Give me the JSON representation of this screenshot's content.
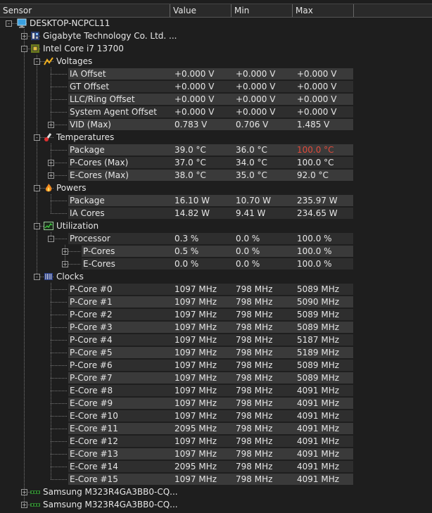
{
  "columns": [
    "Sensor",
    "Value",
    "Min",
    "Max"
  ],
  "tree": [
    {
      "depth": 0,
      "icon": "computer-icon",
      "label": "DESKTOP-NCPCL11",
      "expander": "-"
    },
    {
      "depth": 1,
      "icon": "motherboard-icon",
      "label": "Gigabyte Technology Co. Ltd. ...",
      "expander": "+"
    },
    {
      "depth": 1,
      "icon": "cpu-icon",
      "label": "Intel Core i7 13700",
      "expander": "-"
    },
    {
      "depth": 2,
      "icon": "voltage-icon",
      "label": "Voltages",
      "expander": "-"
    },
    {
      "depth": 3,
      "label": "IA Offset",
      "value": "+0.000 V",
      "min": "+0.000 V",
      "max": "+0.000 V"
    },
    {
      "depth": 3,
      "label": "GT Offset",
      "value": "+0.000 V",
      "min": "+0.000 V",
      "max": "+0.000 V"
    },
    {
      "depth": 3,
      "label": "LLC/Ring Offset",
      "value": "+0.000 V",
      "min": "+0.000 V",
      "max": "+0.000 V"
    },
    {
      "depth": 3,
      "label": "System Agent Offset",
      "value": "+0.000 V",
      "min": "+0.000 V",
      "max": "+0.000 V"
    },
    {
      "depth": 3,
      "label": "VID (Max)",
      "value": "0.783 V",
      "min": "0.706 V",
      "max": "1.485 V",
      "expander": "+"
    },
    {
      "depth": 2,
      "icon": "thermometer-icon",
      "label": "Temperatures",
      "expander": "-"
    },
    {
      "depth": 3,
      "label": "Package",
      "value": "39.0 °C",
      "min": "36.0 °C",
      "max": "100.0 °C",
      "maxColor": "#e04a3a"
    },
    {
      "depth": 3,
      "label": "P-Cores (Max)",
      "value": "37.0 °C",
      "min": "34.0 °C",
      "max": "100.0 °C",
      "expander": "+"
    },
    {
      "depth": 3,
      "label": "E-Cores (Max)",
      "value": "38.0 °C",
      "min": "35.0 °C",
      "max": "92.0 °C",
      "expander": "+"
    },
    {
      "depth": 2,
      "icon": "flame-icon",
      "label": "Powers",
      "expander": "-"
    },
    {
      "depth": 3,
      "label": "Package",
      "value": "16.10 W",
      "min": "10.70 W",
      "max": "235.97 W"
    },
    {
      "depth": 3,
      "label": "IA Cores",
      "value": "14.82 W",
      "min": "9.41 W",
      "max": "234.65 W"
    },
    {
      "depth": 2,
      "icon": "utilization-icon",
      "label": "Utilization",
      "expander": "-"
    },
    {
      "depth": 3,
      "label": "Processor",
      "value": "0.3 %",
      "min": "0.0 %",
      "max": "100.0 %",
      "expander": "-"
    },
    {
      "depth": 4,
      "label": "P-Cores",
      "value": "0.5 %",
      "min": "0.0 %",
      "max": "100.0 %",
      "expander": "+"
    },
    {
      "depth": 4,
      "label": "E-Cores",
      "value": "0.0 %",
      "min": "0.0 %",
      "max": "100.0 %",
      "expander": "+"
    },
    {
      "depth": 2,
      "icon": "clock-icon",
      "label": "Clocks",
      "expander": "-"
    },
    {
      "depth": 3,
      "label": "P-Core #0",
      "value": "1097 MHz",
      "min": "798 MHz",
      "max": "5089 MHz"
    },
    {
      "depth": 3,
      "label": "P-Core #1",
      "value": "1097 MHz",
      "min": "798 MHz",
      "max": "5090 MHz"
    },
    {
      "depth": 3,
      "label": "P-Core #2",
      "value": "1097 MHz",
      "min": "798 MHz",
      "max": "5089 MHz"
    },
    {
      "depth": 3,
      "label": "P-Core #3",
      "value": "1097 MHz",
      "min": "798 MHz",
      "max": "5089 MHz"
    },
    {
      "depth": 3,
      "label": "P-Core #4",
      "value": "1097 MHz",
      "min": "798 MHz",
      "max": "5187 MHz"
    },
    {
      "depth": 3,
      "label": "P-Core #5",
      "value": "1097 MHz",
      "min": "798 MHz",
      "max": "5189 MHz"
    },
    {
      "depth": 3,
      "label": "P-Core #6",
      "value": "1097 MHz",
      "min": "798 MHz",
      "max": "5089 MHz"
    },
    {
      "depth": 3,
      "label": "P-Core #7",
      "value": "1097 MHz",
      "min": "798 MHz",
      "max": "5089 MHz"
    },
    {
      "depth": 3,
      "label": "E-Core #8",
      "value": "1097 MHz",
      "min": "798 MHz",
      "max": "4091 MHz"
    },
    {
      "depth": 3,
      "label": "E-Core #9",
      "value": "1097 MHz",
      "min": "798 MHz",
      "max": "4091 MHz"
    },
    {
      "depth": 3,
      "label": "E-Core #10",
      "value": "1097 MHz",
      "min": "798 MHz",
      "max": "4091 MHz"
    },
    {
      "depth": 3,
      "label": "E-Core #11",
      "value": "2095 MHz",
      "min": "798 MHz",
      "max": "4091 MHz"
    },
    {
      "depth": 3,
      "label": "E-Core #12",
      "value": "1097 MHz",
      "min": "798 MHz",
      "max": "4091 MHz"
    },
    {
      "depth": 3,
      "label": "E-Core #13",
      "value": "1097 MHz",
      "min": "798 MHz",
      "max": "4091 MHz"
    },
    {
      "depth": 3,
      "label": "E-Core #14",
      "value": "2095 MHz",
      "min": "798 MHz",
      "max": "4091 MHz"
    },
    {
      "depth": 3,
      "label": "E-Core #15",
      "value": "1097 MHz",
      "min": "798 MHz",
      "max": "4091 MHz"
    },
    {
      "depth": 1,
      "icon": "ram-icon",
      "label": "Samsung M323R4GA3BB0-CQ...",
      "expander": "+"
    },
    {
      "depth": 1,
      "icon": "ram-icon",
      "label": "Samsung M323R4GA3BB0-CQ...",
      "expander": "+"
    }
  ]
}
